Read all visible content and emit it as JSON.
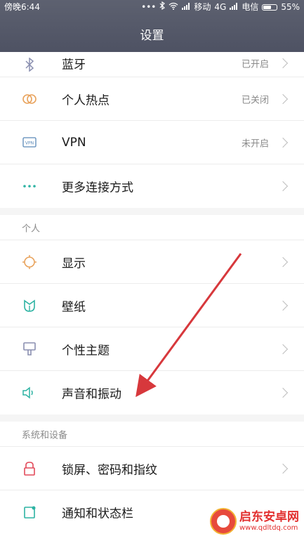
{
  "status_bar": {
    "time": "傍晚6:44",
    "carrier_1": "移动",
    "network": "4G",
    "carrier_2": "电信",
    "battery": "55%",
    "icons": [
      "more-dots-icon",
      "bluetooth-icon",
      "wifi-icon",
      "signal-icon",
      "signal-icon",
      "battery-icon"
    ]
  },
  "header": {
    "title": "设置"
  },
  "network_section": {
    "items": [
      {
        "label": "蓝牙",
        "value": "已开启",
        "icon": "bluetooth-icon",
        "color": "#8a8fb0"
      },
      {
        "label": "个人热点",
        "value": "已关闭",
        "icon": "hotspot-icon",
        "color": "#e8a25b"
      },
      {
        "label": "VPN",
        "value": "未开启",
        "icon": "vpn-icon",
        "color": "#5a89b8"
      },
      {
        "label": "更多连接方式",
        "value": "",
        "icon": "more-connection-icon",
        "color": "#2db3a3"
      }
    ]
  },
  "personal_section": {
    "title": "个人",
    "items": [
      {
        "label": "显示",
        "icon": "display-icon",
        "color": "#e8a25b"
      },
      {
        "label": "壁纸",
        "icon": "wallpaper-icon",
        "color": "#2db3a3"
      },
      {
        "label": "个性主题",
        "icon": "theme-icon",
        "color": "#8a8fb0"
      },
      {
        "label": "声音和振动",
        "icon": "sound-icon",
        "color": "#2db3a3"
      }
    ]
  },
  "system_section": {
    "title": "系统和设备",
    "items": [
      {
        "label": "锁屏、密码和指纹",
        "icon": "lock-icon",
        "color": "#e24a5a"
      },
      {
        "label": "通知和状态栏",
        "icon": "notification-icon",
        "color": "#2db3a3"
      }
    ]
  },
  "watermark": {
    "name": "启东安卓网",
    "url": "www.qdltdq.com"
  },
  "colors": {
    "header_bg": "#555a6b",
    "annotation_arrow": "#d7383c"
  }
}
